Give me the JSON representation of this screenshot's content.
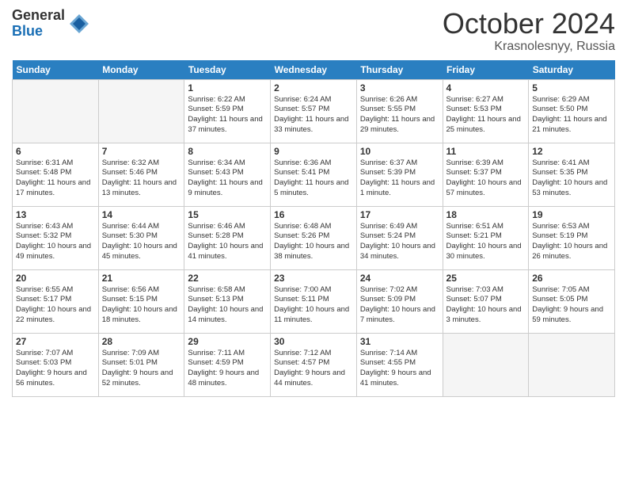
{
  "header": {
    "logo_general": "General",
    "logo_blue": "Blue",
    "month": "October 2024",
    "location": "Krasnolesnyy, Russia"
  },
  "weekdays": [
    "Sunday",
    "Monday",
    "Tuesday",
    "Wednesday",
    "Thursday",
    "Friday",
    "Saturday"
  ],
  "weeks": [
    [
      {
        "day": "",
        "empty": true
      },
      {
        "day": "",
        "empty": true
      },
      {
        "day": "1",
        "sunrise": "6:22 AM",
        "sunset": "5:59 PM",
        "daylight": "11 hours and 37 minutes."
      },
      {
        "day": "2",
        "sunrise": "6:24 AM",
        "sunset": "5:57 PM",
        "daylight": "11 hours and 33 minutes."
      },
      {
        "day": "3",
        "sunrise": "6:26 AM",
        "sunset": "5:55 PM",
        "daylight": "11 hours and 29 minutes."
      },
      {
        "day": "4",
        "sunrise": "6:27 AM",
        "sunset": "5:53 PM",
        "daylight": "11 hours and 25 minutes."
      },
      {
        "day": "5",
        "sunrise": "6:29 AM",
        "sunset": "5:50 PM",
        "daylight": "11 hours and 21 minutes."
      }
    ],
    [
      {
        "day": "6",
        "sunrise": "6:31 AM",
        "sunset": "5:48 PM",
        "daylight": "11 hours and 17 minutes."
      },
      {
        "day": "7",
        "sunrise": "6:32 AM",
        "sunset": "5:46 PM",
        "daylight": "11 hours and 13 minutes."
      },
      {
        "day": "8",
        "sunrise": "6:34 AM",
        "sunset": "5:43 PM",
        "daylight": "11 hours and 9 minutes."
      },
      {
        "day": "9",
        "sunrise": "6:36 AM",
        "sunset": "5:41 PM",
        "daylight": "11 hours and 5 minutes."
      },
      {
        "day": "10",
        "sunrise": "6:37 AM",
        "sunset": "5:39 PM",
        "daylight": "11 hours and 1 minute."
      },
      {
        "day": "11",
        "sunrise": "6:39 AM",
        "sunset": "5:37 PM",
        "daylight": "10 hours and 57 minutes."
      },
      {
        "day": "12",
        "sunrise": "6:41 AM",
        "sunset": "5:35 PM",
        "daylight": "10 hours and 53 minutes."
      }
    ],
    [
      {
        "day": "13",
        "sunrise": "6:43 AM",
        "sunset": "5:32 PM",
        "daylight": "10 hours and 49 minutes."
      },
      {
        "day": "14",
        "sunrise": "6:44 AM",
        "sunset": "5:30 PM",
        "daylight": "10 hours and 45 minutes."
      },
      {
        "day": "15",
        "sunrise": "6:46 AM",
        "sunset": "5:28 PM",
        "daylight": "10 hours and 41 minutes."
      },
      {
        "day": "16",
        "sunrise": "6:48 AM",
        "sunset": "5:26 PM",
        "daylight": "10 hours and 38 minutes."
      },
      {
        "day": "17",
        "sunrise": "6:49 AM",
        "sunset": "5:24 PM",
        "daylight": "10 hours and 34 minutes."
      },
      {
        "day": "18",
        "sunrise": "6:51 AM",
        "sunset": "5:21 PM",
        "daylight": "10 hours and 30 minutes."
      },
      {
        "day": "19",
        "sunrise": "6:53 AM",
        "sunset": "5:19 PM",
        "daylight": "10 hours and 26 minutes."
      }
    ],
    [
      {
        "day": "20",
        "sunrise": "6:55 AM",
        "sunset": "5:17 PM",
        "daylight": "10 hours and 22 minutes."
      },
      {
        "day": "21",
        "sunrise": "6:56 AM",
        "sunset": "5:15 PM",
        "daylight": "10 hours and 18 minutes."
      },
      {
        "day": "22",
        "sunrise": "6:58 AM",
        "sunset": "5:13 PM",
        "daylight": "10 hours and 14 minutes."
      },
      {
        "day": "23",
        "sunrise": "7:00 AM",
        "sunset": "5:11 PM",
        "daylight": "10 hours and 11 minutes."
      },
      {
        "day": "24",
        "sunrise": "7:02 AM",
        "sunset": "5:09 PM",
        "daylight": "10 hours and 7 minutes."
      },
      {
        "day": "25",
        "sunrise": "7:03 AM",
        "sunset": "5:07 PM",
        "daylight": "10 hours and 3 minutes."
      },
      {
        "day": "26",
        "sunrise": "7:05 AM",
        "sunset": "5:05 PM",
        "daylight": "9 hours and 59 minutes."
      }
    ],
    [
      {
        "day": "27",
        "sunrise": "7:07 AM",
        "sunset": "5:03 PM",
        "daylight": "9 hours and 56 minutes."
      },
      {
        "day": "28",
        "sunrise": "7:09 AM",
        "sunset": "5:01 PM",
        "daylight": "9 hours and 52 minutes."
      },
      {
        "day": "29",
        "sunrise": "7:11 AM",
        "sunset": "4:59 PM",
        "daylight": "9 hours and 48 minutes."
      },
      {
        "day": "30",
        "sunrise": "7:12 AM",
        "sunset": "4:57 PM",
        "daylight": "9 hours and 44 minutes."
      },
      {
        "day": "31",
        "sunrise": "7:14 AM",
        "sunset": "4:55 PM",
        "daylight": "9 hours and 41 minutes."
      },
      {
        "day": "",
        "empty": true
      },
      {
        "day": "",
        "empty": true
      }
    ]
  ]
}
